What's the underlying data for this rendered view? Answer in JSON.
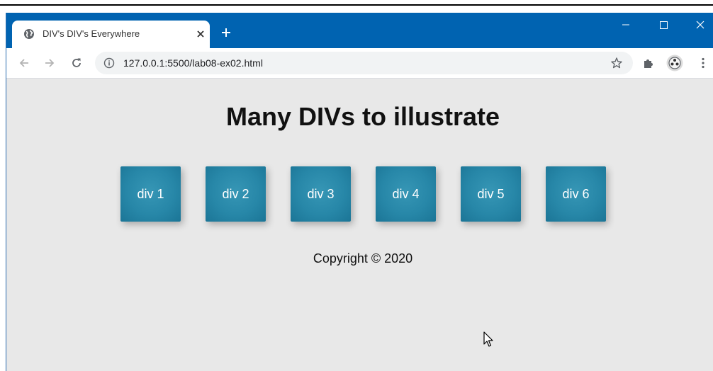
{
  "browser": {
    "tab": {
      "title": "DIV's DIV's Everywhere"
    },
    "address": {
      "url": "127.0.0.1:5500/lab08-ex02.html"
    }
  },
  "page": {
    "heading": "Many DIVs to illustrate",
    "boxes": [
      "div 1",
      "div 2",
      "div 3",
      "div 4",
      "div 5",
      "div 6"
    ],
    "footer": "Copyright © 2020"
  },
  "colors": {
    "titlebar": "#0063b1",
    "box": "#2787a8",
    "page_bg": "#e8e8e8"
  },
  "icons": {
    "favicon": "globe-icon",
    "close_tab": "close-icon",
    "new_tab": "plus-icon",
    "back": "arrow-left-icon",
    "forward": "arrow-right-icon",
    "reload": "reload-icon",
    "site_info": "info-icon",
    "bookmark": "star-icon",
    "extensions": "puzzle-icon",
    "profile": "profile-avatar-icon",
    "menu": "kebab-menu-icon",
    "pointer": "mouse-cursor-icon"
  }
}
